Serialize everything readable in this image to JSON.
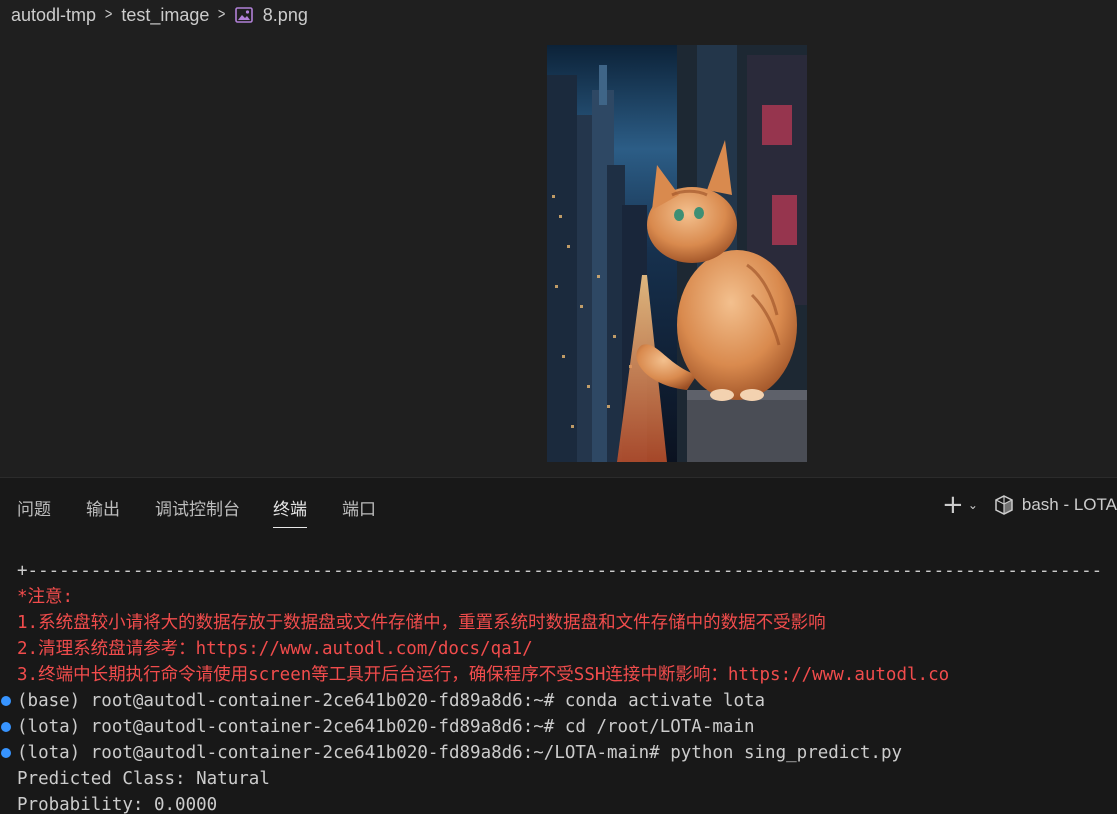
{
  "breadcrumb": {
    "items": [
      "autodl-tmp",
      "test_image"
    ],
    "file": "8.png",
    "separator": ">"
  },
  "image_viewer": {
    "subject": "orange-tabby-cat-on-skyscraper-ledge"
  },
  "panel": {
    "tabs": [
      "问题",
      "输出",
      "调试控制台",
      "终端",
      "端口"
    ],
    "active_tab": "终端",
    "terminal_name": "bash - LOTA",
    "plus_label": "+",
    "chevron": "⌄"
  },
  "terminal": {
    "lines": [
      {
        "text": "+------------------------------------------------------------------------------------------------------",
        "style": "normal",
        "dot": false
      },
      {
        "text": "*注意:",
        "style": "red",
        "dot": false
      },
      {
        "text": "1.系统盘较小请将大的数据存放于数据盘或文件存储中，重置系统时数据盘和文件存储中的数据不受影响",
        "style": "red",
        "dot": false
      },
      {
        "text": "2.清理系统盘请参考：https://www.autodl.com/docs/qa1/",
        "style": "red",
        "dot": false
      },
      {
        "text": "3.终端中长期执行命令请使用screen等工具开后台运行，确保程序不受SSH连接中断影响：https://www.autodl.co",
        "style": "red",
        "dot": false
      },
      {
        "text": "(base) root@autodl-container-2ce641b020-fd89a8d6:~# conda activate lota",
        "style": "normal",
        "dot": true
      },
      {
        "text": "(lota) root@autodl-container-2ce641b020-fd89a8d6:~# cd /root/LOTA-main",
        "style": "normal",
        "dot": true
      },
      {
        "text": "(lota) root@autodl-container-2ce641b020-fd89a8d6:~/LOTA-main# python sing_predict.py",
        "style": "normal",
        "dot": true
      },
      {
        "text": "Predicted Class: Natural",
        "style": "normal",
        "dot": false
      },
      {
        "text": "Probability: 0.0000",
        "style": "normal",
        "dot": false
      }
    ]
  },
  "colors": {
    "background": "#1f1f1f",
    "panel": "#181818",
    "text": "#cccccc",
    "error_red": "#f14c4c",
    "dot_blue": "#3794ff"
  }
}
